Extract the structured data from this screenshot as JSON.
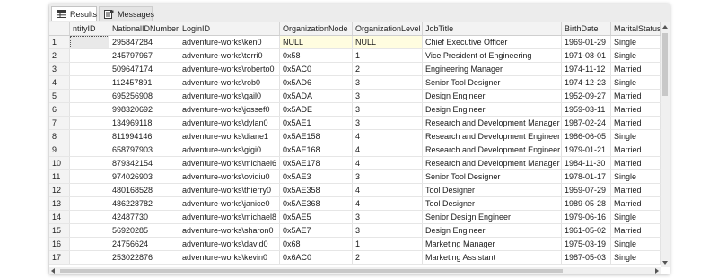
{
  "tabs": {
    "results": "Results",
    "messages": "Messages"
  },
  "columns": [
    "ntityID",
    "NationalIDNumber",
    "LoginID",
    "OrganizationNode",
    "OrganizationLevel",
    "JobTitle",
    "BirthDate",
    "MaritalStatus"
  ],
  "rows": [
    {
      "n": "1",
      "vals": [
        "",
        "295847284",
        "adventure-works\\ken0",
        "NULL",
        "NULL",
        "Chief Executive Officer",
        "1969-01-29",
        "Single"
      ]
    },
    {
      "n": "2",
      "vals": [
        "",
        "245797967",
        "adventure-works\\terri0",
        "0x58",
        "1",
        "Vice President of Engineering",
        "1971-08-01",
        "Single"
      ]
    },
    {
      "n": "3",
      "vals": [
        "",
        "509647174",
        "adventure-works\\roberto0",
        "0x5AC0",
        "2",
        "Engineering Manager",
        "1974-11-12",
        "Married"
      ]
    },
    {
      "n": "4",
      "vals": [
        "",
        "112457891",
        "adventure-works\\rob0",
        "0x5AD6",
        "3",
        "Senior Tool Designer",
        "1974-12-23",
        "Single"
      ]
    },
    {
      "n": "5",
      "vals": [
        "",
        "695256908",
        "adventure-works\\gail0",
        "0x5ADA",
        "3",
        "Design Engineer",
        "1952-09-27",
        "Married"
      ]
    },
    {
      "n": "6",
      "vals": [
        "",
        "998320692",
        "adventure-works\\jossef0",
        "0x5ADE",
        "3",
        "Design Engineer",
        "1959-03-11",
        "Married"
      ]
    },
    {
      "n": "7",
      "vals": [
        "",
        "134969118",
        "adventure-works\\dylan0",
        "0x5AE1",
        "3",
        "Research and Development Manager",
        "1987-02-24",
        "Married"
      ]
    },
    {
      "n": "8",
      "vals": [
        "",
        "811994146",
        "adventure-works\\diane1",
        "0x5AE158",
        "4",
        "Research and Development Engineer",
        "1986-06-05",
        "Single"
      ]
    },
    {
      "n": "9",
      "vals": [
        "",
        "658797903",
        "adventure-works\\gigi0",
        "0x5AE168",
        "4",
        "Research and Development Engineer",
        "1979-01-21",
        "Married"
      ]
    },
    {
      "n": "10",
      "vals": [
        "",
        "879342154",
        "adventure-works\\michael6",
        "0x5AE178",
        "4",
        "Research and Development Manager",
        "1984-11-30",
        "Married"
      ]
    },
    {
      "n": "11",
      "vals": [
        "",
        "974026903",
        "adventure-works\\ovidiu0",
        "0x5AE3",
        "3",
        "Senior Tool Designer",
        "1978-01-17",
        "Single"
      ]
    },
    {
      "n": "12",
      "vals": [
        "",
        "480168528",
        "adventure-works\\thierry0",
        "0x5AE358",
        "4",
        "Tool Designer",
        "1959-07-29",
        "Married"
      ]
    },
    {
      "n": "13",
      "vals": [
        "",
        "486228782",
        "adventure-works\\janice0",
        "0x5AE368",
        "4",
        "Tool Designer",
        "1989-05-28",
        "Married"
      ]
    },
    {
      "n": "14",
      "vals": [
        "",
        "42487730",
        "adventure-works\\michael8",
        "0x5AE5",
        "3",
        "Senior Design Engineer",
        "1979-06-16",
        "Single"
      ]
    },
    {
      "n": "15",
      "vals": [
        "",
        "56920285",
        "adventure-works\\sharon0",
        "0x5AE7",
        "3",
        "Design Engineer",
        "1961-05-02",
        "Married"
      ]
    },
    {
      "n": "16",
      "vals": [
        "",
        "24756624",
        "adventure-works\\david0",
        "0x68",
        "1",
        "Marketing Manager",
        "1975-03-19",
        "Single"
      ]
    },
    {
      "n": "17",
      "vals": [
        "",
        "253022876",
        "adventure-works\\kevin0",
        "0x6AC0",
        "2",
        "Marketing Assistant",
        "1987-05-03",
        "Single"
      ]
    }
  ]
}
